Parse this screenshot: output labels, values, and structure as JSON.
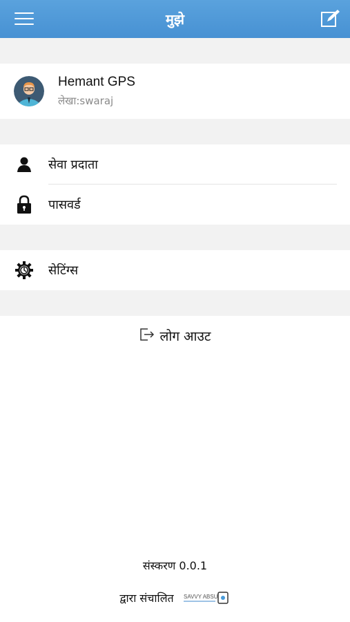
{
  "header": {
    "title": "मुझे",
    "menu_icon": "hamburger-menu-icon",
    "edit_icon": "edit-icon"
  },
  "profile": {
    "name": "Hemant GPS",
    "account": "लेखा:swaraj",
    "avatar_icon": "user-avatar-icon"
  },
  "menu": [
    {
      "label": "सेवा प्रदाता",
      "icon": "person-icon"
    },
    {
      "label": "पासवर्ड",
      "icon": "lock-icon"
    }
  ],
  "settings": {
    "label": "सेटिंग्स",
    "icon": "gear-icon"
  },
  "logout": {
    "label": "लोग आउट",
    "icon": "logout-icon"
  },
  "footer": {
    "version": "संस्करण 0.0.1",
    "powered_by": "द्वारा संचालित",
    "brand_text": "SAVVY ABSU",
    "brand_logo": "savvy-absu-logo"
  },
  "colors": {
    "header": "#4f98d8",
    "gap": "#f2f2f2"
  }
}
